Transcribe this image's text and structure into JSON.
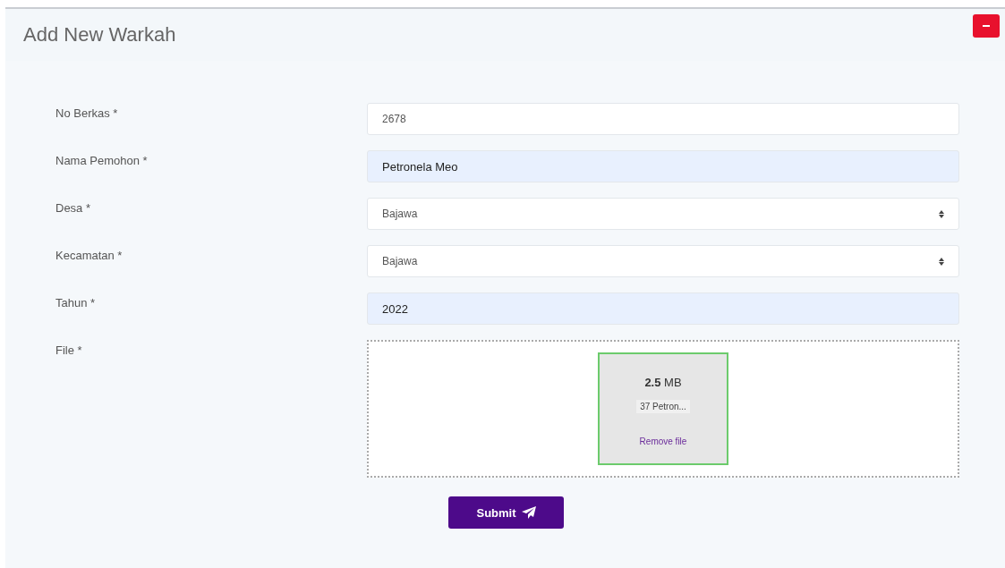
{
  "card": {
    "title": "Add New Warkah"
  },
  "fields": [
    {
      "label": "No Berkas *",
      "kind": "text",
      "value": "2678",
      "autofilled": false
    },
    {
      "label": "Nama Pemohon *",
      "kind": "text",
      "value": "Petronela Meo",
      "autofilled": true
    },
    {
      "label": "Desa *",
      "kind": "select",
      "value": "Bajawa",
      "autofilled": false
    },
    {
      "label": "Kecamatan *",
      "kind": "select",
      "value": "Bajawa",
      "autofilled": false
    },
    {
      "label": "Tahun *",
      "kind": "text",
      "value": "2022",
      "autofilled": true
    },
    {
      "label": "File *",
      "kind": "file",
      "file": {
        "size": "**2.5** MB",
        "name": "37 Petron...",
        "remove": "Remove file"
      }
    }
  ],
  "submit": {
    "label": "Submit"
  }
}
